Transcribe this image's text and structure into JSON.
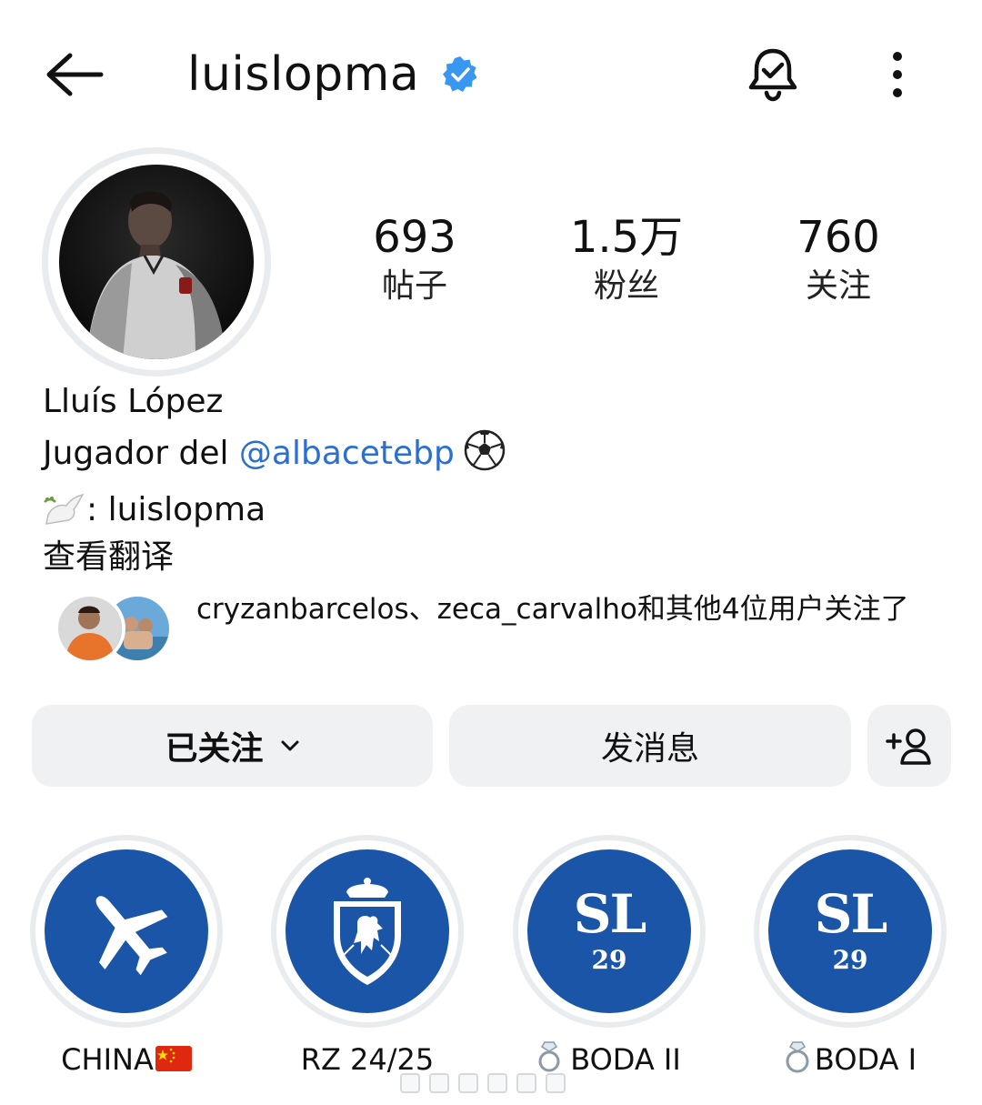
{
  "header": {
    "username": "luislopma",
    "back_icon": "arrow-left-icon",
    "verified_icon": "verified-badge-icon",
    "bell_icon": "bell-check-icon",
    "more_icon": "more-vertical-icon"
  },
  "stats": [
    {
      "value": "693",
      "label": "帖子"
    },
    {
      "value": "1.5万",
      "label": "粉丝"
    },
    {
      "value": "760",
      "label": "关注"
    }
  ],
  "profile": {
    "full_name": "Lluís López",
    "bio_prefix": "Jugador del ",
    "bio_mention": "@albacetebp",
    "bio_line2": ": luislopma",
    "translate_label": "查看翻译"
  },
  "mutual": {
    "text": "cryzanbarcelos、zeca_carvalho和其他4位用户关注了"
  },
  "actions": {
    "following_label": "已关注",
    "message_label": "发消息"
  },
  "highlights": [
    {
      "label": "CHINA",
      "icon": "airplane-icon"
    },
    {
      "label": "RZ 24/25",
      "icon": "real-zaragoza-crest-icon"
    },
    {
      "label": "BODA II",
      "icon": "ring-icon",
      "badge_top": "SL",
      "badge_bottom": "29"
    },
    {
      "label": "BODA I",
      "icon": "ring-icon",
      "badge_top": "SL",
      "badge_bottom": "29"
    }
  ],
  "colors": {
    "accent": "#1b55a7",
    "mention": "#2a6fd1",
    "verified": "#3897f0",
    "button_bg": "#eff1f3"
  }
}
